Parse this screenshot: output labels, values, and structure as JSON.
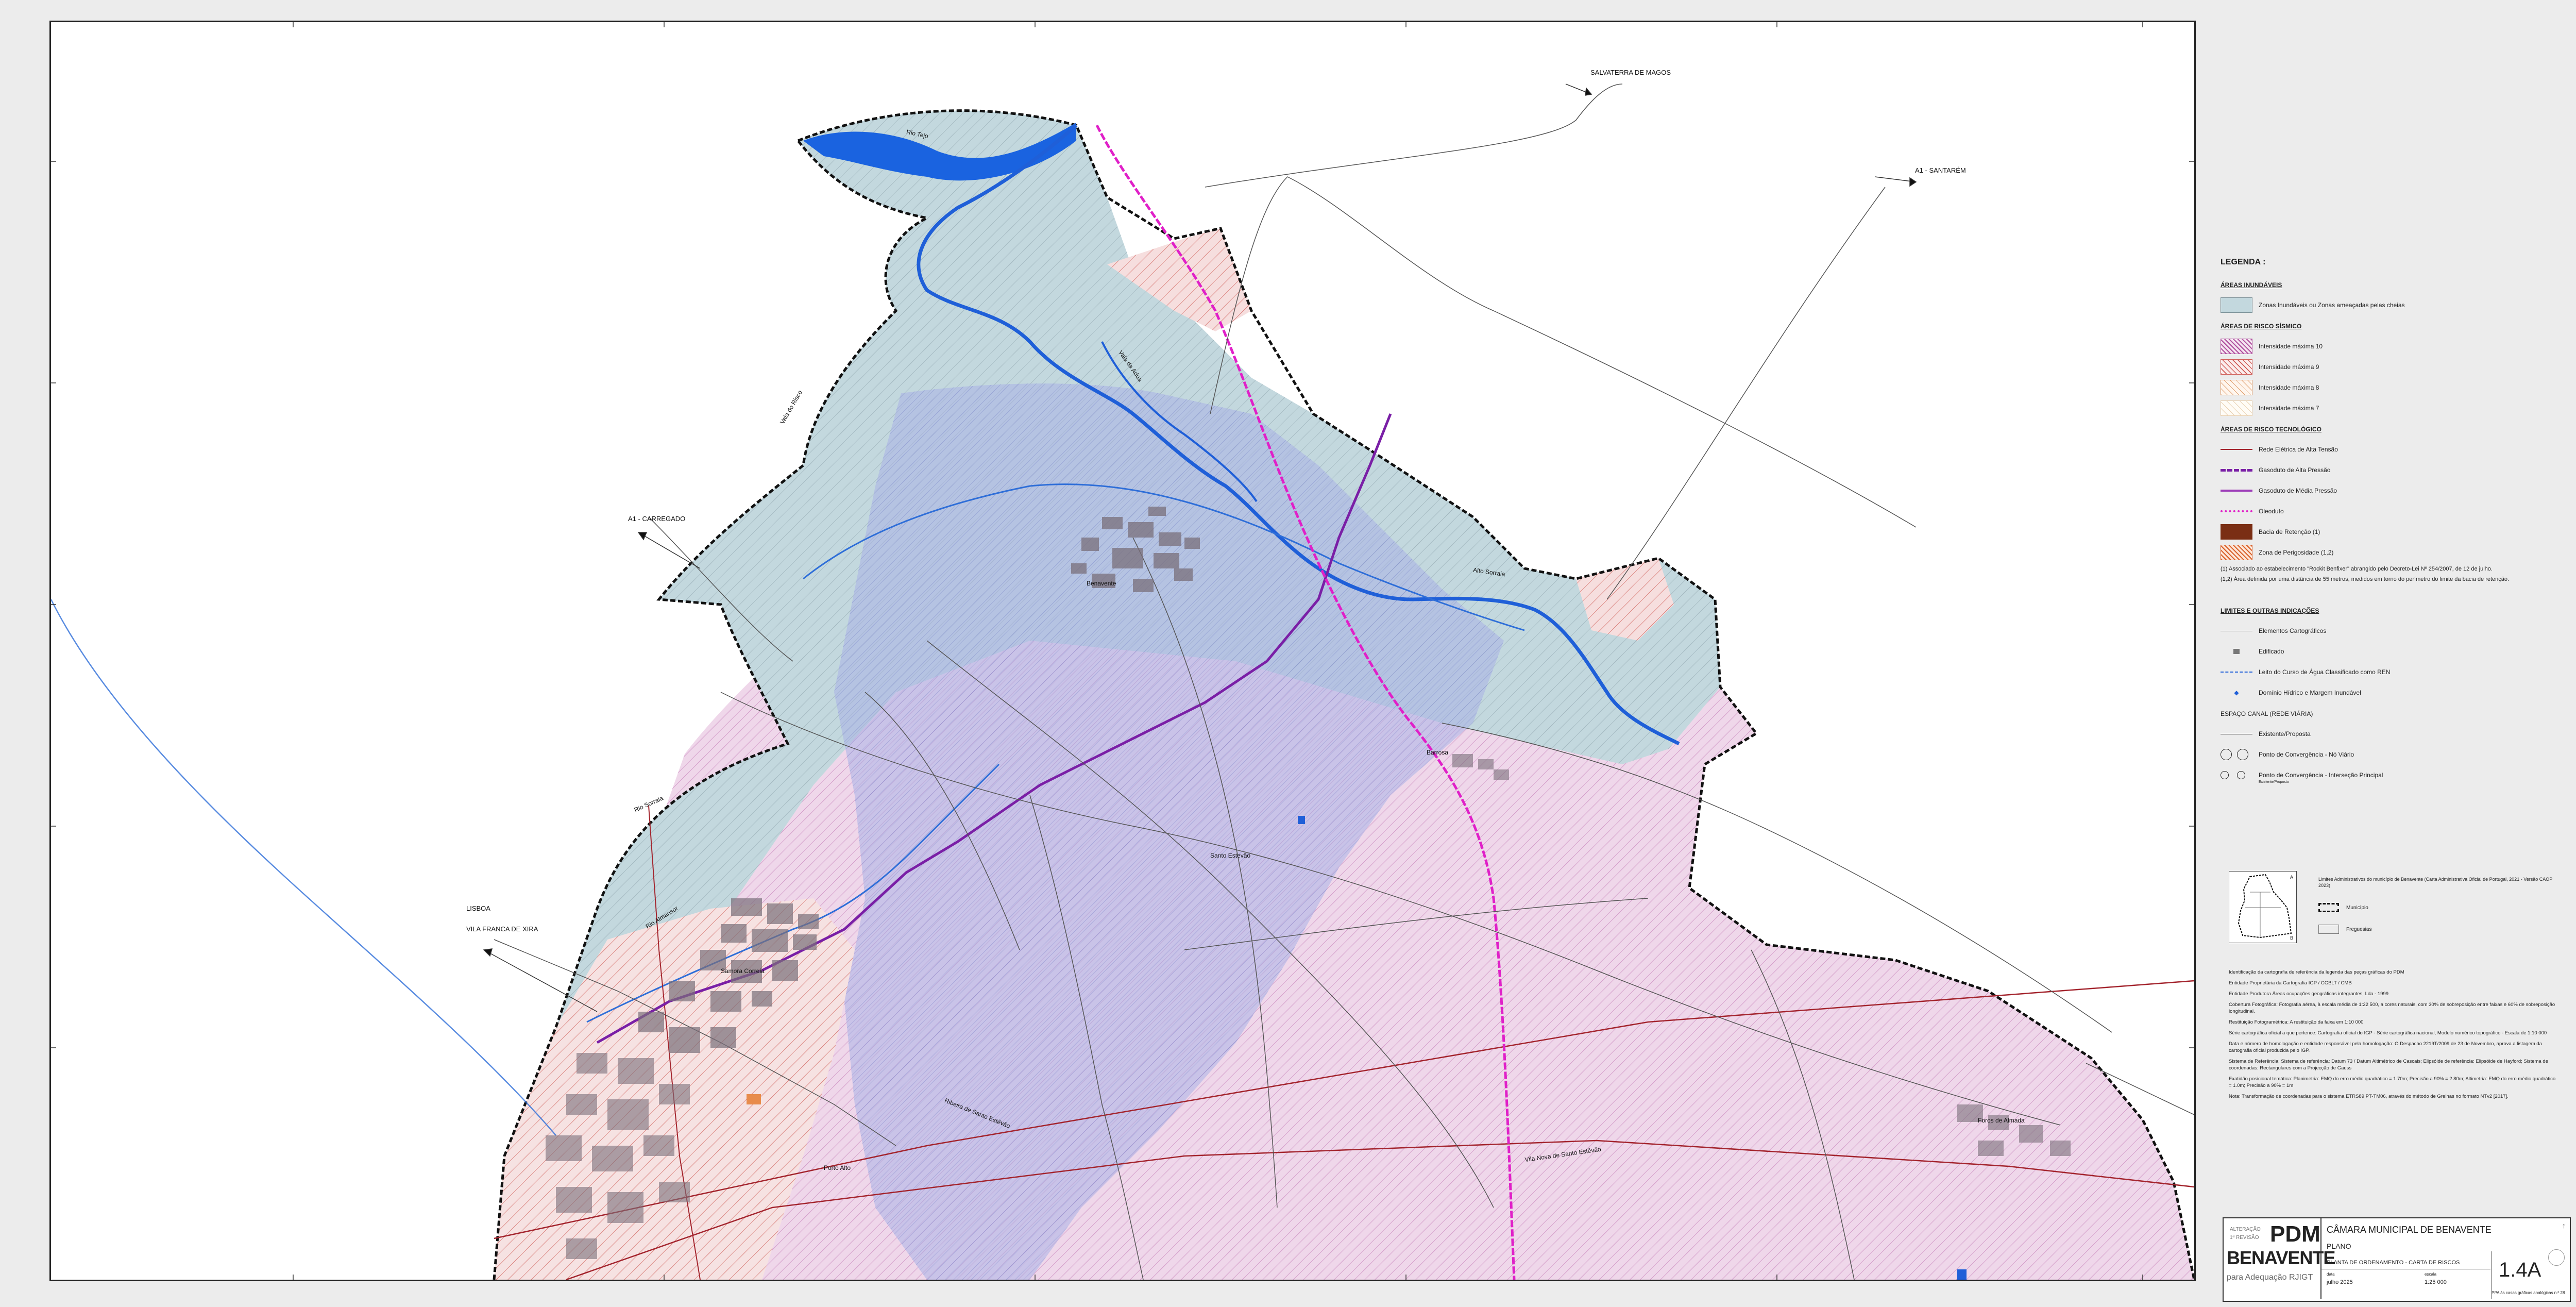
{
  "map": {
    "directions": {
      "salvaterra": "SALVATERRA DE MAGOS",
      "santarem": "A1 - SANTARÉM",
      "carregado": "A1 - CARREGADO",
      "lisboa": "LISBOA",
      "vila_franca": "VILA FRANCA DE XIRA"
    },
    "places": {
      "benavente": "Benavente",
      "samora_correia": "Samora Correia",
      "porto_alto": "Porto Alto",
      "barrosa": "Barrosa",
      "santo_estevao": "Santo Estevão",
      "vila_nova": "Vila Nova de Santo Estêvão",
      "foros_almada": "Foros de Almada"
    },
    "rivers": {
      "tejo": "Rio Tejo",
      "sorraia": "Rio Sorraia",
      "almansor": "Rio Almansor",
      "vala_risco": "Vala do Risco",
      "vala_adua": "Vala da Adua",
      "alto_sorraia": "Alto Sorraia",
      "ribeira_sto_estevao": "Ribeira de Santo Estêvão"
    }
  },
  "legend": {
    "title": "LEGENDA :",
    "sec_inund": "ÁREAS INUNDÁVEIS",
    "zonas_inund": "Zonas Inundáveis ou Zonas ameaçadas pelas cheias",
    "sec_sismico": "ÁREAS DE RISCO SÍSMICO",
    "int10": "Intensidade máxima 10",
    "int9": "Intensidade máxima 9",
    "int8": "Intensidade máxima 8",
    "int7": "Intensidade máxima 7",
    "sec_tecno": "ÁREAS DE RISCO TECNOLÓGICO",
    "rede_eletrica": "Rede Elétrica de Alta Tensão",
    "gas_alta": "Gasoduto de Alta Pressão",
    "gas_media": "Gasoduto de Média Pressão",
    "oleoduto": "Oleoduto",
    "bacia": "Bacia de Retenção (1)",
    "perigosidade": "Zona de Perigosidade (1,2)",
    "note1": "(1) Associado ao estabelecimento \"Rockit Benfixer\" abrangido pelo Decreto-Lei Nº 254/2007, de 12 de julho.",
    "note2": "(1,2) Área definida por uma distância de 55 metros, medidos em torno do perímetro do limite da bacia de retenção.",
    "sec_limites": "LIMITES E OUTRAS INDICAÇÕES",
    "elementos": "Elementos Cartográficos",
    "edificado": "Edificado",
    "leito": "Leito do Curso de Água Classificado como REN",
    "dominio": "Domínio Hídrico e Margem Inundável",
    "sec_canal": "ESPAÇO CANAL (REDE VIÁRIA)",
    "existente": "Existente/Proposta",
    "ponto_no": "Ponto de Convergência - Nó Viário",
    "ponto_int": "Ponto de Convergência - Interseção Principal",
    "sub_prop": "Existente/Proposto"
  },
  "inset": {
    "text": "Limites Administrativos do município de Benavente (Carta Administrativa Oficial de Portugal, 2021 - Versão CAOP 2023)",
    "municipio": "Município",
    "freguesias": "Freguesias",
    "a": "A",
    "b": "B"
  },
  "metadata": [
    "Identificação da cartografia de referência da legenda das peças gráficas do PDM",
    "Entidade Proprietária da Cartografia IGP / CGBLT / CMB",
    "Entidade Produtora Áreas ocupações geográficas integrantes, Lda - 1999",
    "Cobertura Fotográfica: Fotografia aérea, à escala média de 1:22 500, a cores naturais, com 30% de sobreposição entre faixas e 60% de sobreposição longitudinal.",
    "Restituição Fotogramétrica: A restituição da faixa em 1:10 000",
    "Série cartográfica oficial a que pertence: Cartografia oficial do IGP - Série cartográfica nacional, Modelo numérico topográfico - Escala de 1:10 000",
    "Data e número de homologação e entidade responsável pela homologação: O Despacho 2219T/2009 de 23 de Novembro, aprova a listagem da cartografia oficial produzida pelo IGP.",
    "Sistema de Referência: Sistema de referência: Datum 73 / Datum Altimétrico de Cascais; Elipsóide de referência: Elipsóide de Hayford; Sistema de coordenadas: Rectangulares com a Projecção de Gauss",
    "Exatidão posicional temática: Planimetria: EMQ do erro médio quadrático = 1.70m; Precisão a 90% = 2.80m; Altimetria: EMQ do erro médio quadrático = 1.0m; Precisão a 90% = 1m",
    "Nota: Transformação de coordenadas para o sistema ETRS89 PT-TM06, através do método de Grelhas no formato NTv2 [2017]."
  ],
  "titleblock": {
    "logo_top1": "ALTERAÇÃO",
    "logo_top2": "1ª REVISÃO",
    "logo_pdm": "PDM",
    "logo_name": "BENAVENTE",
    "logo_sub": "para Adequação RJIGT",
    "entity": "CÂMARA MUNICIPAL DE BENAVENTE",
    "phase": "PLANO",
    "drawing": "PLANTA DE ORDENAMENTO - CARTA DE RISCOS",
    "date_label": "data",
    "date": "julho 2025",
    "scale_label": "escala",
    "scale": "1:25 000",
    "code": "1.4A",
    "foot": "PPA às casas gráficas analógicas n.º 28"
  },
  "colors": {
    "flood": "#c3d8de",
    "seismic10": "#b0529f",
    "seismic9": "#d0605a",
    "blue_zone": "#8a96d8",
    "river": "#1f5fd8",
    "power": "#a3242d",
    "gas_high": "#7a1fa6",
    "oil": "#e020c8"
  }
}
